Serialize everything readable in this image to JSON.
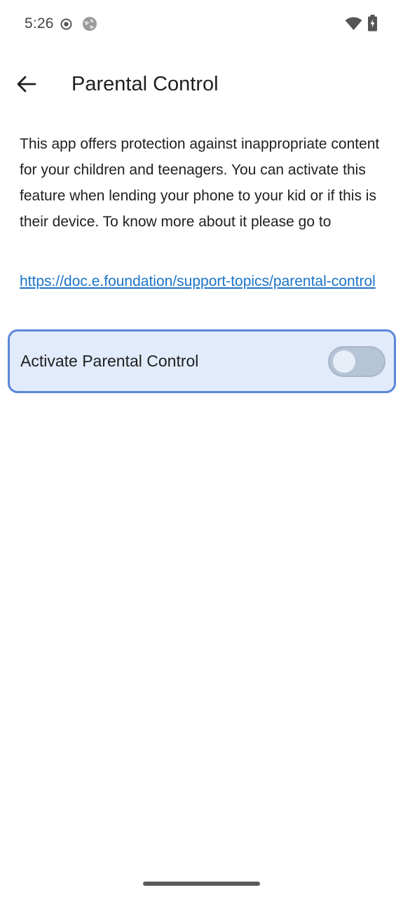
{
  "status_bar": {
    "time": "5:26",
    "icons": [
      "record-dot-icon",
      "globe-icon",
      "wifi-icon",
      "battery-charging-icon"
    ]
  },
  "app_bar": {
    "back_icon": "arrow-left-icon",
    "title": "Parental Control"
  },
  "content": {
    "description": "This app offers protection against inappropriate content for your children and teenagers. You can activate this feature when lending your phone to your kid or if this is their device. To know more about it please go to",
    "link_text": "https://doc.e.foundation/support-topics/parental-control"
  },
  "toggle": {
    "label": "Activate Parental Control",
    "enabled": false
  },
  "colors": {
    "link": "#1a73c8",
    "card_background": "#e2ebfb",
    "card_border": "#5b86dc",
    "switch_track_off": "#b6c4d8"
  }
}
